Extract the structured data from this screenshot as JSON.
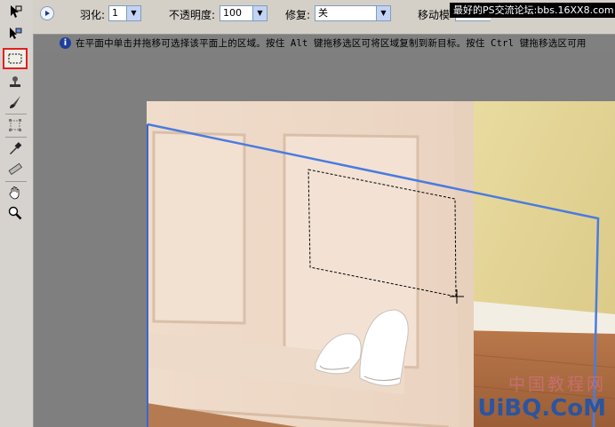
{
  "options_bar": {
    "feather_label": "羽化:",
    "feather_value": "1",
    "opacity_label": "不透明度:",
    "opacity_value": "100",
    "heal_label": "修复:",
    "heal_value": "关",
    "move_mode_label": "移动模",
    "info_text": "在平面中单击并拖移可选择该平面上的区域。按住 Alt 键拖移选区可将区域复制到新目标。按住 Ctrl 键拖移选区可用"
  },
  "watermark_top": "最好的PS交流论坛:bbs.16XX8.com",
  "watermark_bottom": {
    "cn": "中国教程网",
    "en": "UiBQ.CoM"
  },
  "colors": {
    "panel_bg": "#d4d0c8",
    "canvas_bg": "#808080",
    "plane_grid": "#4a7be0",
    "active_tool_outline": "#e02020"
  },
  "tools": [
    "edit-plane-tool-icon",
    "create-plane-tool-icon",
    "marquee-tool-icon",
    "stamp-tool-icon",
    "brush-tool-icon",
    "transform-tool-icon",
    "eyedropper-tool-icon",
    "measure-tool-icon",
    "hand-tool-icon",
    "zoom-tool-icon"
  ]
}
